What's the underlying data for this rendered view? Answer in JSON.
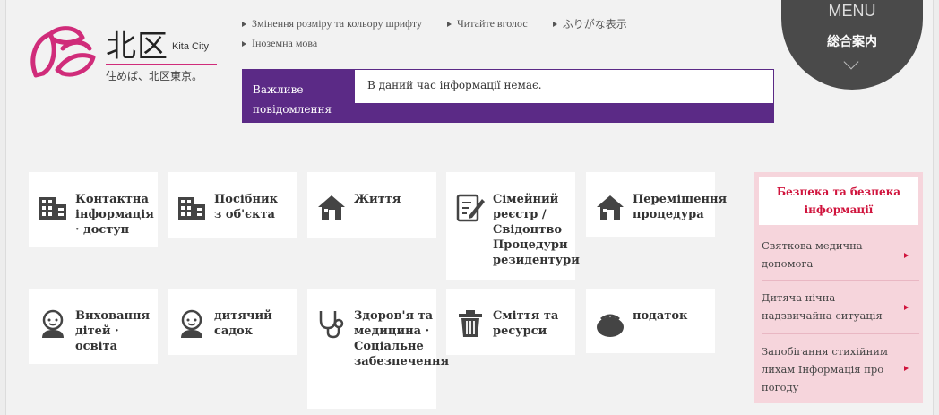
{
  "logo": {
    "kanji": "北区",
    "kita": "Kita City",
    "tagline": "住めば、北区東京。"
  },
  "toplinks": {
    "font_resize": "Змінення розміру та кольору шрифту",
    "read_aloud": "Читайте вголос",
    "furigana": "ふりがな表示",
    "foreign_language": "Іноземна мова"
  },
  "notice": {
    "label": "Важливе повідомлення",
    "text": "В даний час інформації немає."
  },
  "menu": {
    "en": "MENU",
    "ja": "総合案内"
  },
  "tiles": [
    {
      "label": "Контактна інформація · доступ",
      "icon": "building-icon"
    },
    {
      "label": "Посібник з об'єкта",
      "icon": "building-icon"
    },
    {
      "label": "Життя",
      "icon": "house-icon"
    },
    {
      "label": "Сімейний реєстр / Свідоцтво Процедури резидентури",
      "icon": "document-pen-icon"
    },
    {
      "label": "Переміщення процедура",
      "icon": "house-icon"
    },
    {
      "label": "Виховання дітей · освіта",
      "icon": "baby-icon"
    },
    {
      "label": "дитячий садок",
      "icon": "baby-icon"
    },
    {
      "label": "Здоров'я та медицина · Соціальне забезпечення",
      "icon": "stethoscope-icon"
    },
    {
      "label": "Сміття та ресурси",
      "icon": "trash-icon"
    },
    {
      "label": "податок",
      "icon": "purse-icon"
    }
  ],
  "sidebar": {
    "header": "Безпека та безпека інформації",
    "items": [
      {
        "label": "Святкова медична допомога"
      },
      {
        "label": "Дитяча нічна надзвичайна ситуація"
      },
      {
        "label": "Запобігання стихійним лихам Інформація про погоду"
      }
    ]
  },
  "colors": {
    "accent_purple": "#5b2a86",
    "accent_pink": "#d02c7a",
    "alert_red": "#d0143d",
    "sidebar_pink": "#f6d5dc",
    "menu_gray": "#4a4a4a"
  }
}
